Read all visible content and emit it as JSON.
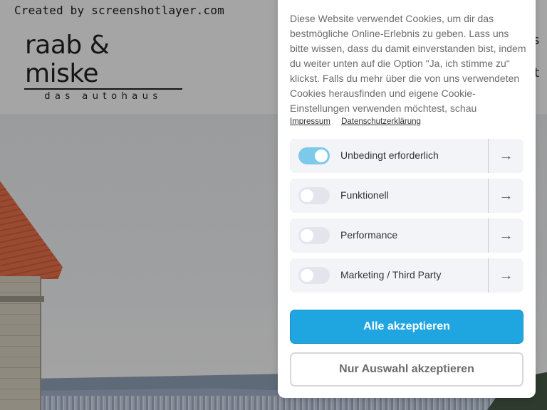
{
  "watermark": "Created by screenshotlayer.com",
  "logo": {
    "main": "raab & miske",
    "sub": "das autohaus"
  },
  "nav_fragments": [
    "s",
    "t"
  ],
  "cookie_banner": {
    "intro": "Diese Website verwendet Cookies, um dir das bestmögliche Online-Erlebnis zu geben. Lass uns bitte wissen, dass du damit einverstanden bist, indem du weiter unten auf die Option \"Ja, ich stimme zu\" klickst. Falls du mehr über die von uns verwendeten Cookies herausfinden und eigene Cookie-Einstellungen verwenden möchtest, schau",
    "links": [
      "Impressum",
      "Datenschutzerklärung"
    ],
    "categories": [
      {
        "label": "Unbedingt erforderlich",
        "enabled": true
      },
      {
        "label": "Funktionell",
        "enabled": false
      },
      {
        "label": "Performance",
        "enabled": false
      },
      {
        "label": "Marketing / Third Party",
        "enabled": false
      }
    ],
    "arrow_icon": "→",
    "accept_all_label": "Alle akzeptieren",
    "accept_selection_label": "Nur Auswahl akzeptieren",
    "accent_color": "#1fa6e0",
    "toggle_on_color": "#7cc9ea"
  }
}
